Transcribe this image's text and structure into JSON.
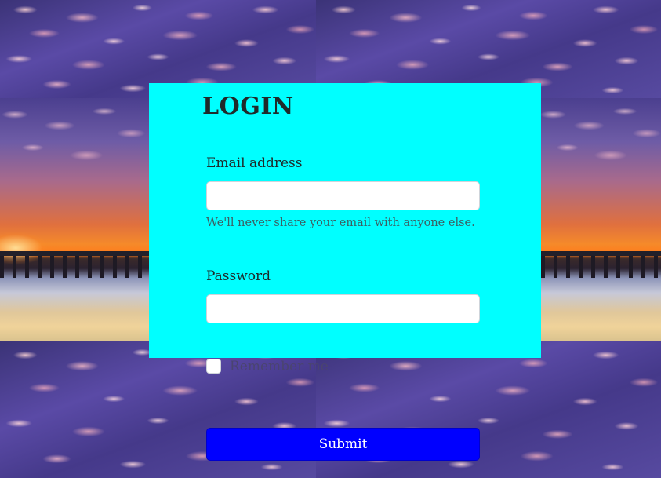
{
  "login": {
    "title": "LOGIN",
    "email_label": "Email address",
    "email_value": "",
    "email_help": "We'll never share your email with anyone else.",
    "password_label": "Password",
    "password_value": "",
    "remember_label": "Remember me",
    "remember_checked": false,
    "submit_label": "Submit"
  },
  "colors": {
    "panel_background": "#00ffff",
    "submit_background": "#0000ff",
    "submit_text": "#ffffff"
  }
}
